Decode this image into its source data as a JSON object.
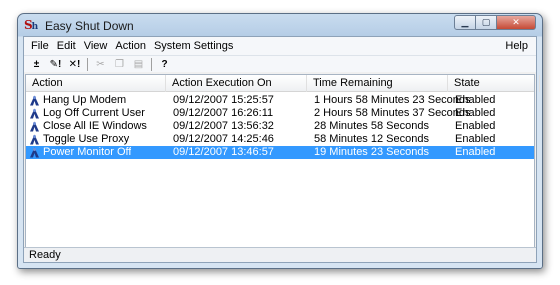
{
  "window": {
    "title": "Easy Shut Down",
    "icon_text": "S",
    "icon_sub": "h"
  },
  "menu": [
    "File",
    "Edit",
    "View",
    "Action",
    "System Settings"
  ],
  "menu_help": "Help",
  "toolbar": {
    "buttons": [
      {
        "icon": "add-action-icon",
        "glyph": "±",
        "enabled": true
      },
      {
        "icon": "edit-action-icon",
        "glyph": "✎!",
        "enabled": true
      },
      {
        "icon": "delete-action-icon",
        "glyph": "✕!",
        "enabled": true
      },
      {
        "icon": "cut-icon",
        "glyph": "✂",
        "enabled": false
      },
      {
        "icon": "copy-icon",
        "glyph": "❐",
        "enabled": false
      },
      {
        "icon": "paste-icon",
        "glyph": "▤",
        "enabled": false
      },
      {
        "icon": "help-icon",
        "glyph": "?",
        "enabled": true
      }
    ]
  },
  "list": {
    "columns": [
      "Action",
      "Action Execution On",
      "Time Remaining",
      "State"
    ],
    "rows": [
      {
        "action": "Hang Up Modem",
        "execution": "09/12/2007 15:25:57",
        "remaining": "1 Hours 58 Minutes 23 Seconds",
        "state": "Enabled",
        "selected": false
      },
      {
        "action": "Log Off Current User",
        "execution": "09/12/2007 16:26:11",
        "remaining": "2 Hours 58 Minutes 37 Seconds",
        "state": "Enabled",
        "selected": false
      },
      {
        "action": "Close All IE Windows",
        "execution": "09/12/2007 13:56:32",
        "remaining": "28 Minutes 58 Seconds",
        "state": "Enabled",
        "selected": false
      },
      {
        "action": "Toggle Use Proxy",
        "execution": "09/12/2007 14:25:46",
        "remaining": "58 Minutes 12 Seconds",
        "state": "Enabled",
        "selected": false
      },
      {
        "action": "Power Monitor Off",
        "execution": "09/12/2007 13:46:57",
        "remaining": "19 Minutes 23 Seconds",
        "state": "Enabled",
        "selected": true
      }
    ]
  },
  "status": {
    "text": "Ready"
  },
  "colors": {
    "selection": "#3399ff",
    "icon_blue": "#1f3a8a"
  }
}
